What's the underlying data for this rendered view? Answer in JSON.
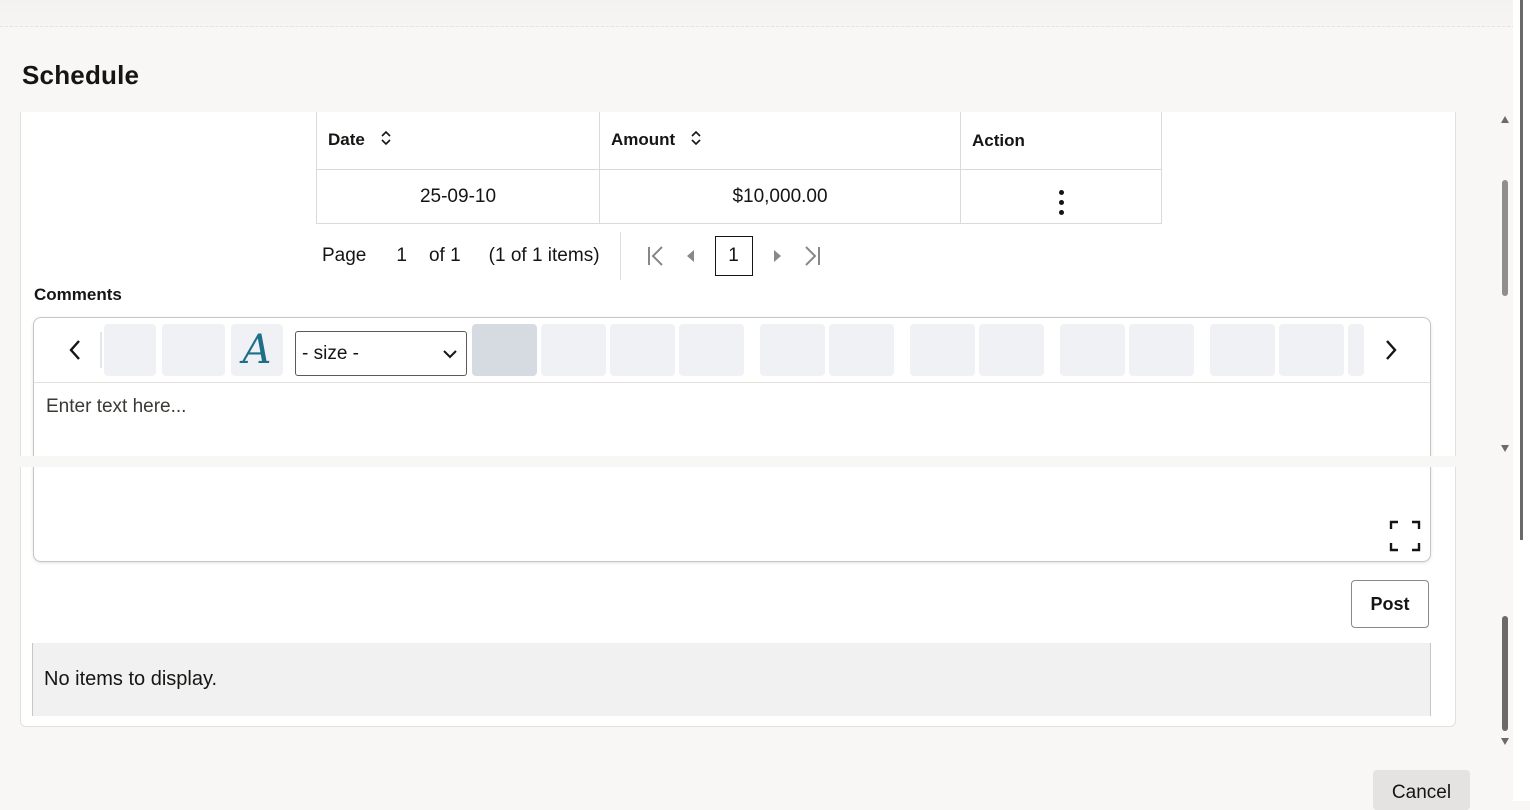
{
  "dialog": {
    "title": "Schedule"
  },
  "table": {
    "headers": [
      "Date",
      "Amount",
      "Action"
    ],
    "rows": [
      {
        "date": "25-09-10",
        "amount": "$10,000.00"
      }
    ]
  },
  "pagination": {
    "page_label": "Page",
    "page_input": "1",
    "of_label": "of 1",
    "items_summary": "(1 of 1 items)",
    "current_page": "1"
  },
  "comments": {
    "label": "Comments",
    "size_select": "- size -",
    "placeholder": "Enter text here..."
  },
  "post_label": "Post",
  "empty_message": "No items to display.",
  "cancel_label": "Cancel",
  "colors": {
    "font_icon_blue": "#1f6f8b",
    "active_toolbar": "#d6dbe2",
    "toolbar_button": "#eff1f5"
  },
  "icons": [
    "sort-icon",
    "kebab-menu-icon",
    "first-page-icon",
    "previous-page-icon",
    "next-page-icon",
    "last-page-icon",
    "chevron-left-icon",
    "chevron-right-icon",
    "font-icon",
    "fullscreen-icon"
  ]
}
